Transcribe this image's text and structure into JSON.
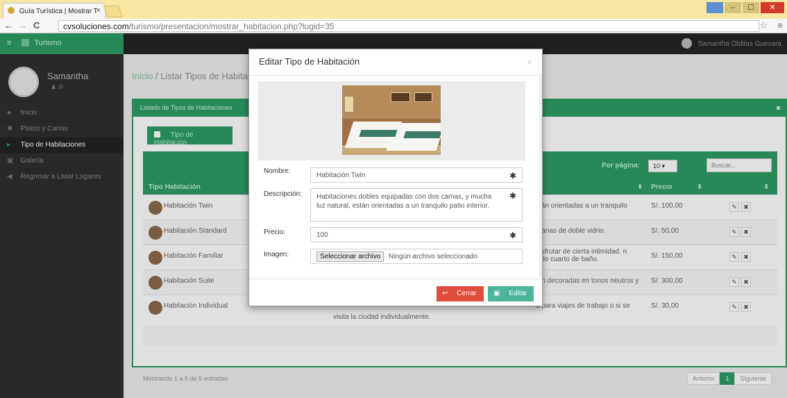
{
  "browser": {
    "tab_title": "Guía Turística | Mostrar T",
    "tab_close": "×",
    "url_domain": "cvsoluciones.com",
    "url_path": "/turismo/presentacion/mostrar_habitacion.php?lugid=35",
    "back": "←",
    "forward": "→",
    "reload": "C",
    "star": "☆",
    "menu": "≡",
    "win_min": "–",
    "win_max": "☐",
    "win_close": "✕"
  },
  "app": {
    "brand_label": "Turismo",
    "menu_icon": "≡",
    "top_user": "Samantha Oblitas Guevara"
  },
  "sidebar": {
    "user_name": "Samantha",
    "user_icons": "♟  ⚙",
    "items": [
      {
        "label": "Inicio",
        "icon": "●"
      },
      {
        "label": "Platos y Cartas",
        "icon": "✖"
      },
      {
        "label": "Tipo de Habitaciones",
        "icon": "▸"
      },
      {
        "label": "Galería",
        "icon": "▣"
      },
      {
        "label": "Regresar a Listar Lugares",
        "icon": "◀"
      }
    ]
  },
  "main": {
    "breadcrumb_home": "Inicio",
    "breadcrumb_sep": " / ",
    "breadcrumb_current": "Listar Tipos de Habitaciones",
    "panel_title": "Listado de Tipos de Habitaciones",
    "add_button": "Tipo de Habitación",
    "per_page_label": "Por página:",
    "per_page_value": "10 ▾",
    "search_placeholder": "Buscar...",
    "columns": {
      "tipo": "Tipo Habitación",
      "sort": "⬍",
      "precio": "Precio",
      "sort2": "⬍",
      "sort3": "⬍"
    },
    "rows": [
      {
        "name": "Habitación Twin",
        "desc": "stán orientadas a un tranquilo",
        "price": "S/. 100,00"
      },
      {
        "name": "Habitación Standard",
        "desc": "ntanas de doble vidrio.",
        "price": "S/. 50,00"
      },
      {
        "name": "Habitación Familiar",
        "desc": "disfrutar de cierta intimidad. n solo cuarto de baño.",
        "price": "S/. 150,00"
      },
      {
        "name": "Habitación Suite",
        "desc": "tán decoradas en tonos neutros y",
        "price": "S/. 300,00"
      },
      {
        "name": "Habitación Individual",
        "desc": "a para viajes de trabajo o si se",
        "price": "S/. 30,00"
      }
    ],
    "row_extra": "visita la ciudad individualmente.",
    "edit_icon": "✎",
    "delete_icon": "✖",
    "showing": "Mostrando 1 a 5 de 5 entradas",
    "pager_prev": "Anterior",
    "pager_current": "1",
    "pager_next": "Siguiente"
  },
  "modal": {
    "title": "Editar Tipo de Habitación",
    "close": "×",
    "name_label": "Nombre:",
    "name_value": "Habitación Twin",
    "desc_label": "Descripción:",
    "desc_value": "Habitaciones dobles equipadas con dos camas, y mucha luz natural, están orientadas a un tranquilo patio interior.",
    "price_label": "Precio:",
    "price_value": "100",
    "image_label": "Imagen:",
    "file_button": "Seleccionar archivo",
    "file_status": "Ningún archivo seleccionado",
    "required_mark": "✱",
    "cancel_button": "Cerrar",
    "cancel_icon": "↩",
    "save_button": "Editar",
    "save_icon": "▣"
  },
  "colors": {
    "accent": "#2d9d64",
    "danger": "#e04d3d",
    "info": "#4bb59a"
  }
}
